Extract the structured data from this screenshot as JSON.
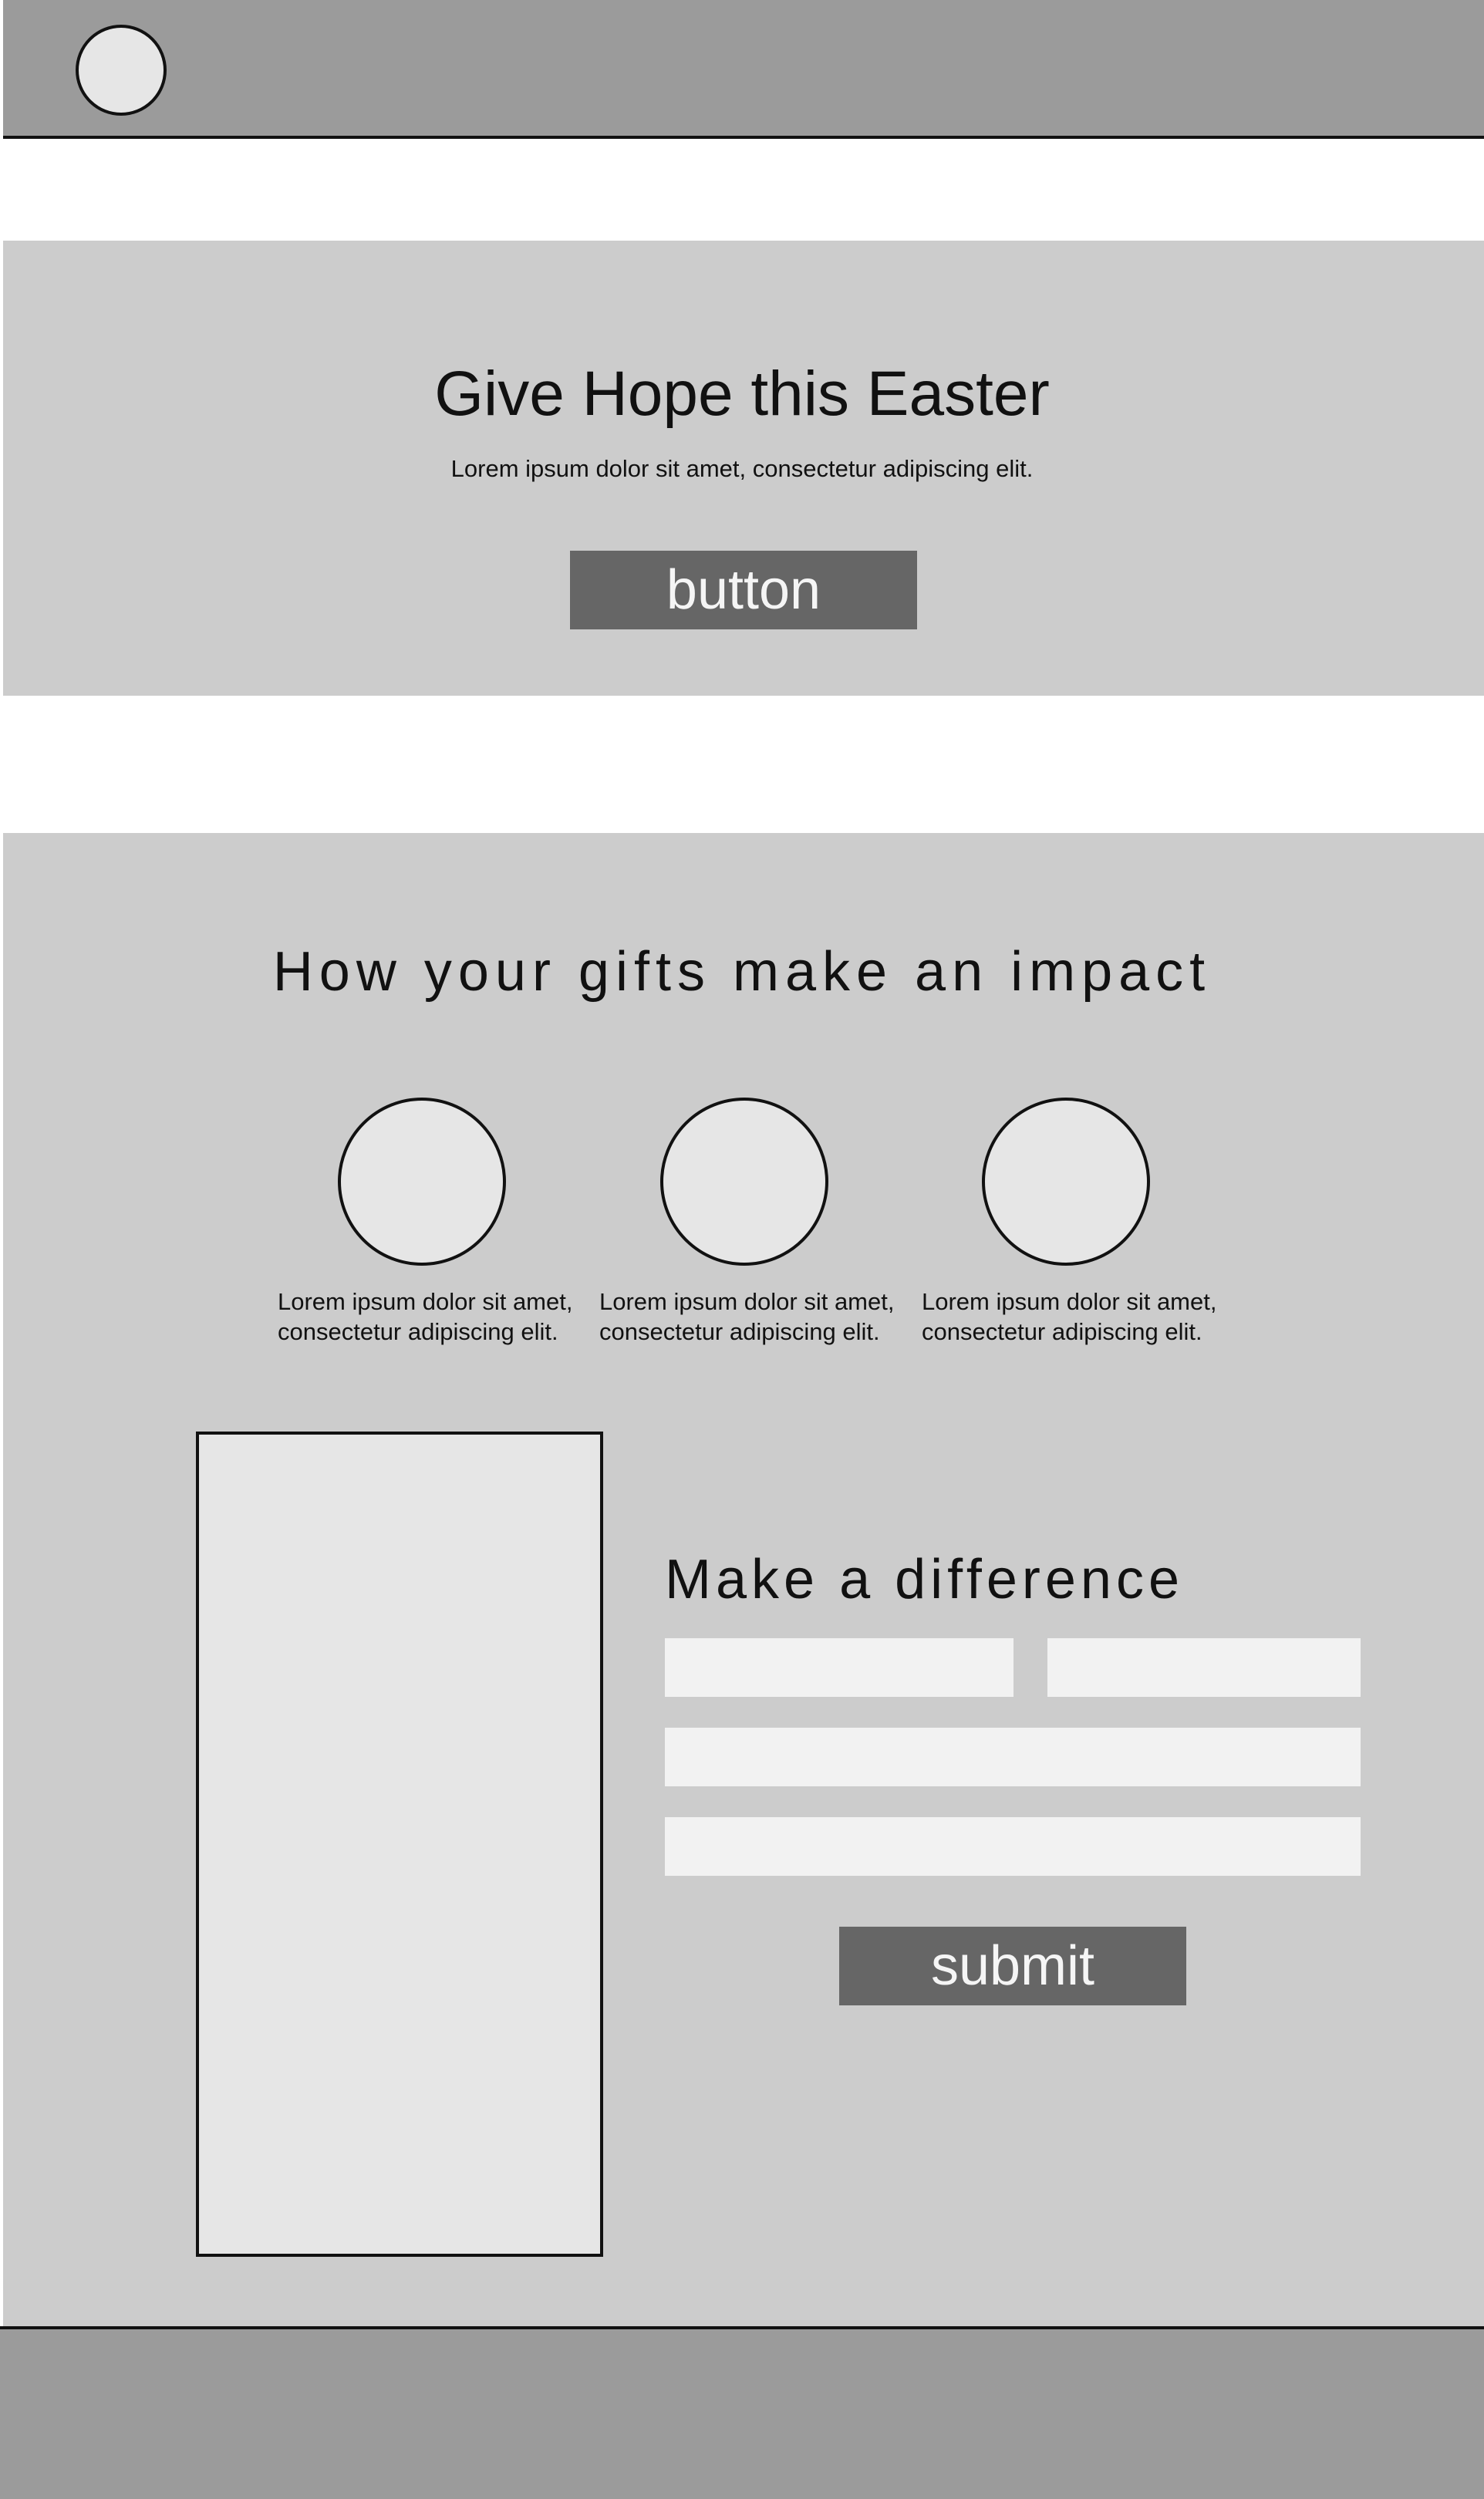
{
  "hero": {
    "title": "Give Hope this Easter",
    "subtitle": "Lorem ipsum dolor sit amet, consectetur adipiscing elit.",
    "button_label": "button"
  },
  "impact": {
    "title": "How your gifts make an impact",
    "items": [
      {
        "line1": "Lorem ipsum dolor sit amet,",
        "line2": "consectetur adipiscing elit."
      },
      {
        "line1": "Lorem ipsum dolor sit amet,",
        "line2": "consectetur adipiscing elit."
      },
      {
        "line1": "Lorem ipsum dolor sit amet,",
        "line2": "consectetur adipiscing elit."
      }
    ]
  },
  "form": {
    "title": "Make a difference",
    "submit_label": "submit"
  },
  "colors": {
    "header_footer": "#9b9b9b",
    "section_bg": "#cccccc",
    "placeholder_fill": "#e6e6e6",
    "field_fill": "#f2f2f2",
    "button_fill": "#666666"
  }
}
